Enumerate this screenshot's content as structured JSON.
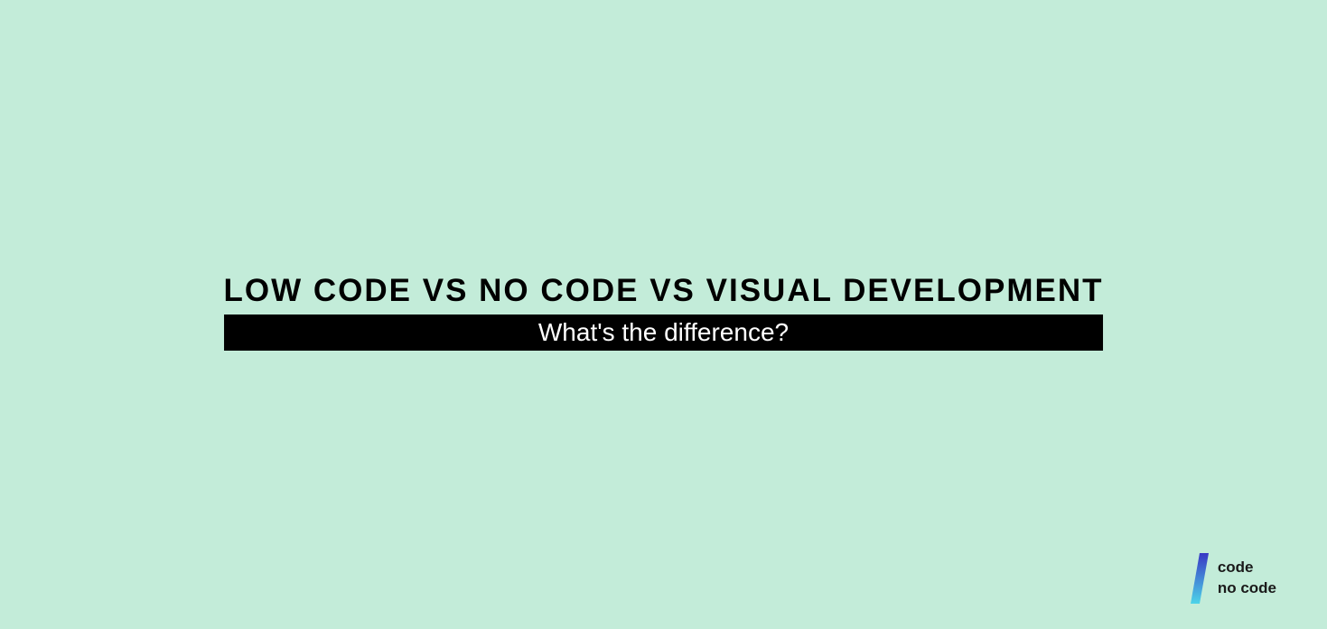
{
  "title": "LOW CODE VS NO CODE VS VISUAL DEVELOPMENT",
  "subtitle": "What's the difference?",
  "logo": {
    "line1": "code",
    "line2": "no code"
  }
}
